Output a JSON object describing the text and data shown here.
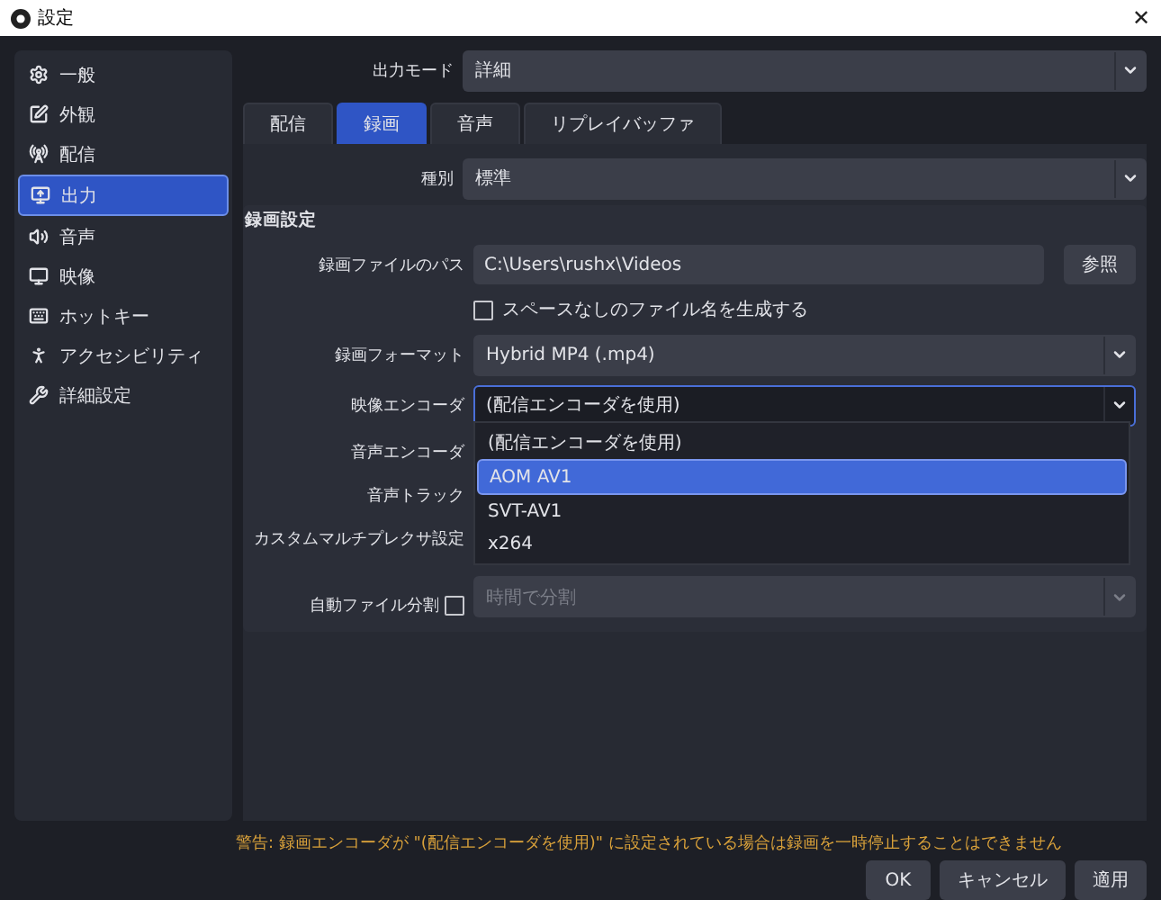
{
  "window": {
    "title": "設定",
    "close": "✕"
  },
  "sidebar": {
    "items": [
      {
        "label": "一般",
        "selected": false
      },
      {
        "label": "外観",
        "selected": false
      },
      {
        "label": "配信",
        "selected": false
      },
      {
        "label": "出力",
        "selected": true
      },
      {
        "label": "音声",
        "selected": false
      },
      {
        "label": "映像",
        "selected": false
      },
      {
        "label": "ホットキー",
        "selected": false
      },
      {
        "label": "アクセシビリティ",
        "selected": false
      },
      {
        "label": "詳細設定",
        "selected": false
      }
    ]
  },
  "output_mode": {
    "label": "出力モード",
    "value": "詳細"
  },
  "tabs": [
    {
      "label": "配信",
      "selected": false
    },
    {
      "label": "録画",
      "selected": true
    },
    {
      "label": "音声",
      "selected": false
    },
    {
      "label": "リプレイバッファ",
      "selected": false
    }
  ],
  "type": {
    "label": "種別",
    "value": "標準"
  },
  "recording_group": {
    "title": "録画設定",
    "rows": [
      {
        "kind": "path",
        "label": "録画ファイルのパス",
        "value": "C:\\Users\\rushx\\Videos",
        "button": "参照"
      },
      {
        "kind": "checkbox",
        "label": "スペースなしのファイル名を生成する",
        "checked": false
      },
      {
        "kind": "select",
        "label": "録画フォーマット",
        "value": "Hybrid MP4 (.mp4)"
      },
      {
        "kind": "open_select",
        "label": "映像エンコーダ",
        "value": "(配信エンコーダを使用)",
        "options": [
          {
            "label": "(配信エンコーダを使用)",
            "highlighted": false
          },
          {
            "label": "AOM AV1",
            "highlighted": true
          },
          {
            "label": "SVT-AV1",
            "highlighted": false
          },
          {
            "label": "x264",
            "highlighted": false
          }
        ]
      },
      {
        "kind": "label",
        "label": "音声エンコーダ"
      },
      {
        "kind": "label",
        "label": "音声トラック"
      },
      {
        "kind": "label",
        "label": "カスタムマルチプレクサ設定"
      },
      {
        "kind": "split",
        "label": "自動ファイル分割",
        "checked": false,
        "value": "時間で分割",
        "disabled": true
      }
    ]
  },
  "warning": "警告: 録画エンコーダが \"(配信エンコーダを使用)\" に設定されている場合は録画を一時停止することはできません",
  "buttons": [
    "OK",
    "キャンセル",
    "適用"
  ]
}
